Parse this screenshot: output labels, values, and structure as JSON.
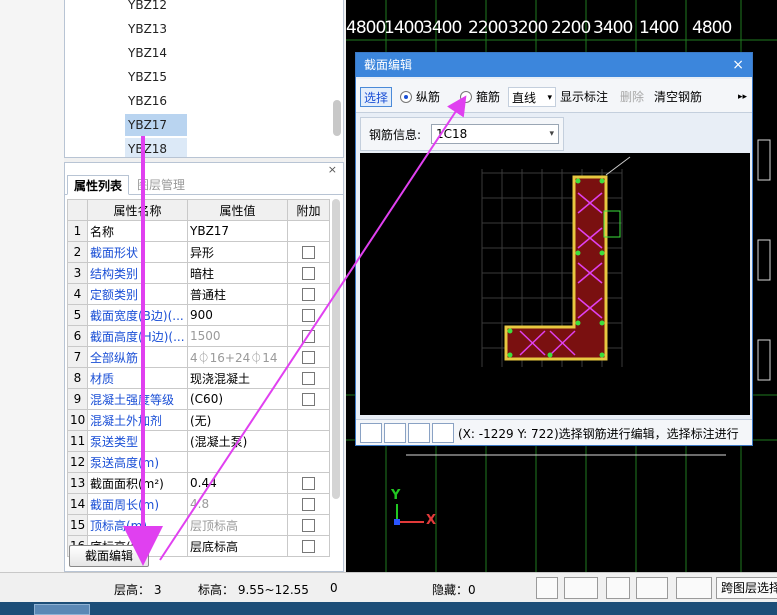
{
  "tree": {
    "items": [
      "YBZ12",
      "YBZ13",
      "YBZ14",
      "YBZ15",
      "YBZ16",
      "YBZ17",
      "YBZ18"
    ],
    "selected": "YBZ17"
  },
  "props": {
    "close": "×",
    "tabs": [
      "属性列表",
      "图层管理"
    ],
    "headers": [
      "属性名称",
      "属性值",
      "附加"
    ],
    "rows": [
      {
        "idx": "1",
        "name": "名称",
        "value": "YBZ17",
        "check": false
      },
      {
        "idx": "2",
        "name": "截面形状",
        "value": "异形",
        "check": true
      },
      {
        "idx": "3",
        "name": "结构类别",
        "value": "暗柱",
        "check": true
      },
      {
        "idx": "4",
        "name": "定额类别",
        "value": "普通柱",
        "check": true
      },
      {
        "idx": "5",
        "name": "截面宽度(B边)(...",
        "value": "900",
        "check": true
      },
      {
        "idx": "6",
        "name": "截面高度(H边)(...",
        "value": "1500",
        "check": true
      },
      {
        "idx": "7",
        "name": "全部纵筋",
        "value": "4⏀16+24⏀14",
        "check": true
      },
      {
        "idx": "8",
        "name": "材质",
        "value": "现浇混凝土",
        "check": true
      },
      {
        "idx": "9",
        "name": "混凝土强度等级",
        "value": "(C60)",
        "check": true
      },
      {
        "idx": "10",
        "name": "混凝土外加剂",
        "value": "(无)",
        "check": false
      },
      {
        "idx": "11",
        "name": "泵送类型",
        "value": "(混凝土泵)",
        "check": false
      },
      {
        "idx": "12",
        "name": "泵送高度(m)",
        "value": "",
        "check": false
      },
      {
        "idx": "13",
        "name": "截面面积(m²)",
        "value": "0.44",
        "check": true
      },
      {
        "idx": "14",
        "name": "截面周长(m)",
        "value": "4.8",
        "check": true
      },
      {
        "idx": "15",
        "name": "顶标高(m)",
        "value": "层顶标高",
        "check": true
      },
      {
        "idx": "16",
        "name": "底标高(m)",
        "value": "层底标高",
        "check": true
      }
    ],
    "edit_button": "截面编辑"
  },
  "cad": {
    "dims": [
      "4800",
      "1400",
      "3400",
      "2200",
      "3200",
      "2200",
      "3400",
      "1400",
      "4800"
    ]
  },
  "dialog": {
    "title": "截面编辑",
    "close": "×",
    "toolbar": {
      "select": "选择",
      "longitudinal": "纵筋",
      "stirrup": "箍筋",
      "line": "直线",
      "show_label": "显示标注",
      "delete": "删除",
      "clear": "清空钢筋",
      "more": "▸▸"
    },
    "rebar_info_label": "钢筋信息:",
    "rebar_info_value": "1C18",
    "status": "(X: -1229 Y: 722)选择钢筋进行编辑，选择标注进行"
  },
  "statusbar": {
    "floor_height": "层高： 3",
    "elevation": "标高： 9.55~12.55",
    "zero": "0",
    "hidden": "隐藏：0",
    "cross_layer": "跨图层选择"
  },
  "colors": {
    "arrow": "#e040f0",
    "dialog_title": "#3c86dc",
    "link_blue": "#1a4fd6"
  }
}
